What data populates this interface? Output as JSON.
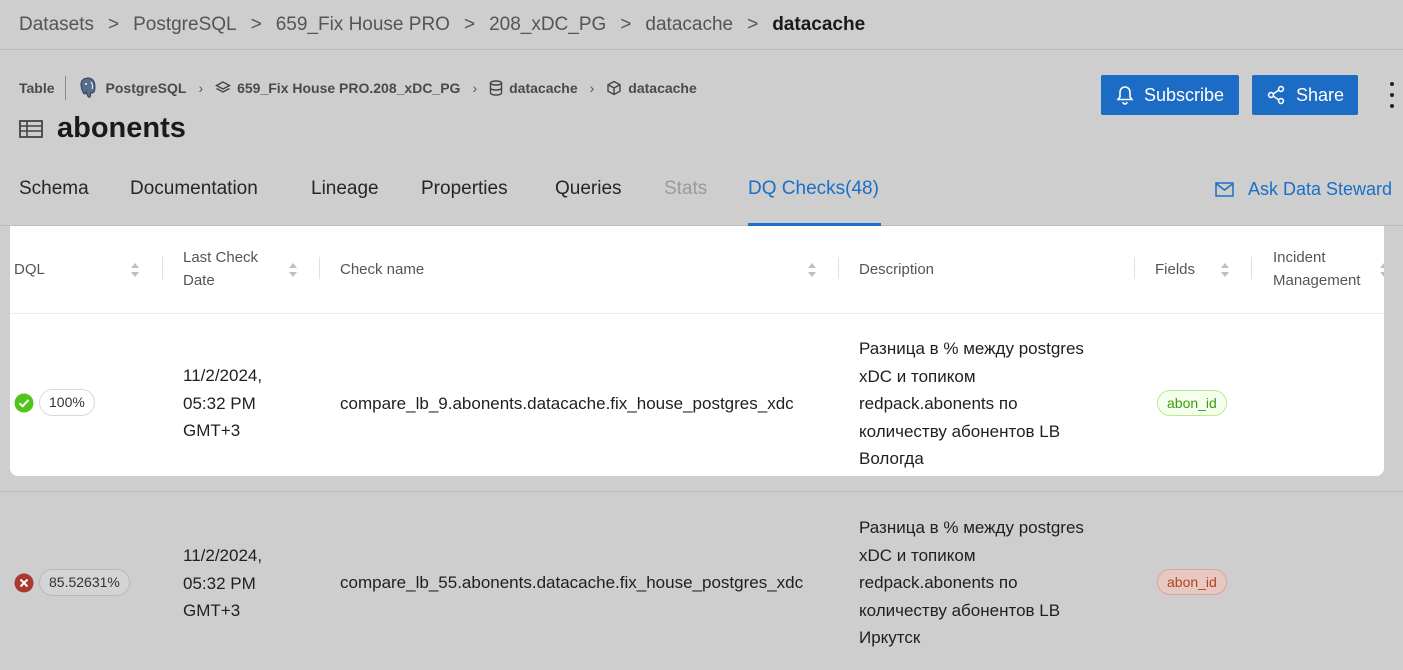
{
  "breadcrumb": [
    "Datasets",
    "PostgreSQL",
    "659_Fix House PRO",
    "208_xDC_PG",
    "datacache",
    "datacache"
  ],
  "entity": {
    "type_label": "Table",
    "platform": "PostgreSQL",
    "path": [
      "659_Fix House PRO.208_xDC_PG",
      "datacache",
      "datacache"
    ],
    "name": "abonents"
  },
  "actions": {
    "subscribe": "Subscribe",
    "share": "Share"
  },
  "tabs": [
    {
      "label": "Schema",
      "state": "normal"
    },
    {
      "label": "Documentation",
      "state": "normal"
    },
    {
      "label": "Lineage",
      "state": "normal"
    },
    {
      "label": "Properties",
      "state": "normal"
    },
    {
      "label": "Queries",
      "state": "normal"
    },
    {
      "label": "Stats",
      "state": "disabled"
    },
    {
      "label": "DQ Checks(48)",
      "state": "active"
    }
  ],
  "ask_steward": "Ask Data Steward",
  "table": {
    "columns": [
      "DQL",
      "Last Check Date",
      "Check name",
      "Description",
      "Fields",
      "Incident Management"
    ],
    "rows": [
      {
        "status": "pass",
        "dql": "100%",
        "date": [
          "11/2/2024,",
          "05:32 PM",
          "GMT+3"
        ],
        "check_name": "compare_lb_9.abonents.datacache.fix_house_postgres_xdc",
        "description": [
          "Разница в % между postgres",
          "xDC и топиком",
          "redpack.abonents по",
          "количеству абонентов LB",
          "Вологда"
        ],
        "field": "abon_id"
      },
      {
        "status": "fail",
        "dql": "85.52631%",
        "date": [
          "11/2/2024,",
          "05:32 PM",
          "GMT+3"
        ],
        "check_name": "compare_lb_55.abonents.datacache.fix_house_postgres_xdc",
        "description": [
          "Разница в % между postgres",
          "xDC и топиком",
          "redpack.abonents по",
          "количеству абонентов LB",
          "Иркутск"
        ],
        "field": "abon_id"
      }
    ]
  },
  "colors": {
    "accent": "#1a6fc9",
    "button": "#1c6bc4",
    "pass": "#52c41a",
    "fail": "#c0392b",
    "overlay": "#cecece"
  }
}
